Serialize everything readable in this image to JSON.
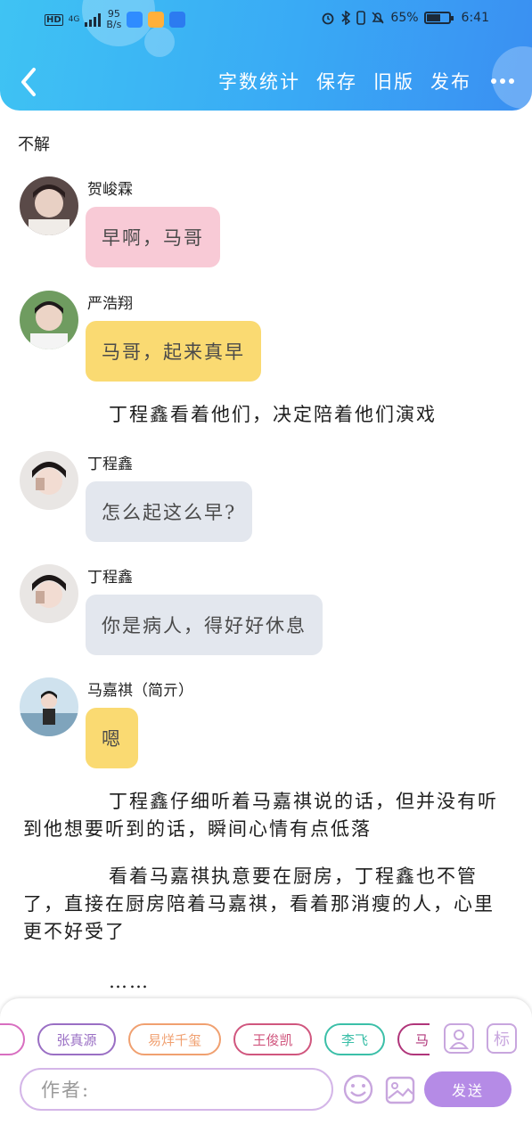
{
  "status_bar": {
    "hd": "HD",
    "net_type": "4G",
    "net_speed_value": "95",
    "net_speed_unit": "B/s",
    "battery": "65%",
    "time": "6:41"
  },
  "toolbar": {
    "word_count": "字数统计",
    "save": "保存",
    "old_version": "旧版",
    "publish": "发布"
  },
  "story_title": "不解",
  "messages": [
    {
      "name": "贺峻霖",
      "text": "早啊，马哥",
      "color": "#f8cad6"
    },
    {
      "name": "严浩翔",
      "text": "马哥，起来真早",
      "color": "#fada72"
    },
    {
      "name": "丁程鑫",
      "text": "怎么起这么早?",
      "color": "#e3e7ee"
    },
    {
      "name": "丁程鑫",
      "text": "你是病人，得好好休息",
      "color": "#e3e7ee"
    },
    {
      "name": "马嘉祺（简亓）",
      "text": "嗯",
      "color": "#fada72"
    }
  ],
  "narrations": [
    "丁程鑫看着他们，决定陪着他们演戏",
    "丁程鑫仔细听着马嘉祺说的话，但并没有听到他想要听到的话，瞬间心情有点低落",
    "看着马嘉祺执意要在厨房，丁程鑫也不管了，直接在厨房陪着马嘉祺，看着那消瘦的人，心里更不好受了",
    "……"
  ],
  "characters": [
    {
      "name": "",
      "color": "#d86ec0"
    },
    {
      "name": "张真源",
      "color": "#9a6fc4"
    },
    {
      "name": "易烊千玺",
      "color": "#f0a070"
    },
    {
      "name": "王俊凯",
      "color": "#d0567e"
    },
    {
      "name": "李飞",
      "color": "#3bbfa8"
    },
    {
      "name": "马",
      "color": "#b0357a"
    }
  ],
  "composer": {
    "author_placeholder": "作者:",
    "send": "发送",
    "role_icon_label": "标"
  }
}
